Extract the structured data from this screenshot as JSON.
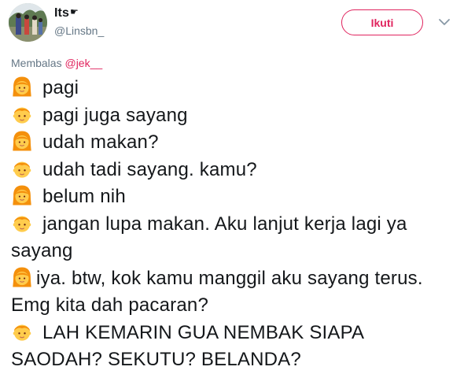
{
  "user": {
    "display_name": "Its",
    "name_emoji": "☛",
    "handle": "@Linsbn_"
  },
  "follow_label": "Ikuti",
  "reply": {
    "prefix": "Membalas",
    "mention": "@jek__"
  },
  "tweet": {
    "lines": [
      {
        "emoji": "girl-emoji",
        "text": "pagi"
      },
      {
        "emoji": "boy-emoji",
        "text": "pagi juga sayang"
      },
      {
        "emoji": "girl-emoji",
        "text": "udah makan?"
      },
      {
        "emoji": "boy-emoji",
        "text": "udah tadi sayang. kamu?"
      },
      {
        "emoji": "girl-emoji",
        "text": "belum nih"
      },
      {
        "emoji": "boy-emoji",
        "text": "jangan lupa makan. Aku lanjut kerja lagi ya sayang"
      },
      {
        "emoji": "girl-emoji",
        "text": "iya. btw, kok kamu manggil aku sayang terus. Emg kita dah pacaran?"
      },
      {
        "emoji": "boy-emoji",
        "text": "LAH KEMARIN GUA NEMBAK SIAPA SAODAH? SEKUTU? BELANDA?"
      }
    ]
  },
  "colors": {
    "accent": "#e0245e",
    "secondary_text": "#657786",
    "primary_text": "#14171a",
    "emoji_skin": "#ffcc4d",
    "emoji_hair": "#f4900c"
  }
}
